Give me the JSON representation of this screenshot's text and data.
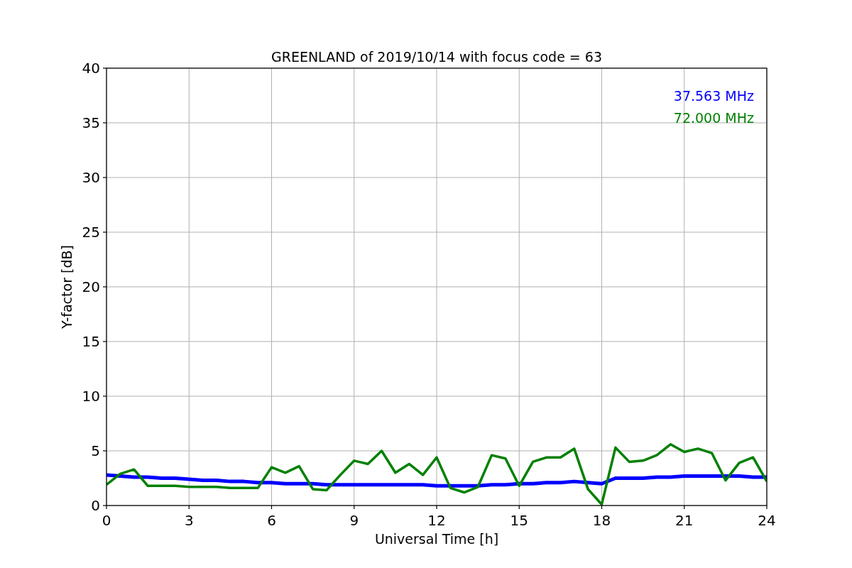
{
  "chart_data": {
    "type": "line",
    "title": "GREENLAND of 2019/10/14 with focus code = 63",
    "xlabel": "Universal Time [h]",
    "ylabel": "Y-factor [dB]",
    "x": [
      0,
      0.5,
      1,
      1.5,
      2,
      2.5,
      3,
      3.5,
      4,
      4.5,
      5,
      5.5,
      6,
      6.5,
      7,
      7.5,
      8,
      8.5,
      9,
      9.5,
      10,
      10.5,
      11,
      11.5,
      12,
      12.5,
      13,
      13.5,
      14,
      14.5,
      15,
      15.5,
      16,
      16.5,
      17,
      17.5,
      18,
      18.5,
      19,
      19.5,
      20,
      20.5,
      21,
      21.5,
      22,
      22.5,
      23,
      23.5,
      24
    ],
    "series": [
      {
        "name": "37.563 MHz",
        "color": "#0000ff",
        "values": [
          2.8,
          2.7,
          2.6,
          2.6,
          2.5,
          2.5,
          2.4,
          2.3,
          2.3,
          2.2,
          2.2,
          2.1,
          2.1,
          2.0,
          2.0,
          2.0,
          1.9,
          1.9,
          1.9,
          1.9,
          1.9,
          1.9,
          1.9,
          1.9,
          1.8,
          1.8,
          1.8,
          1.8,
          1.9,
          1.9,
          2.0,
          2.0,
          2.1,
          2.1,
          2.2,
          2.1,
          2.0,
          2.5,
          2.5,
          2.5,
          2.6,
          2.6,
          2.7,
          2.7,
          2.7,
          2.7,
          2.7,
          2.6,
          2.6
        ]
      },
      {
        "name": "72.000 MHz",
        "color": "#008000",
        "values": [
          1.9,
          2.9,
          3.3,
          1.8,
          1.8,
          1.8,
          1.7,
          1.7,
          1.7,
          1.6,
          1.6,
          1.6,
          3.5,
          3.0,
          3.6,
          1.5,
          1.4,
          2.8,
          4.1,
          3.8,
          5.0,
          3.0,
          3.8,
          2.8,
          4.4,
          1.6,
          1.2,
          1.7,
          4.6,
          4.3,
          1.8,
          4.0,
          4.4,
          4.4,
          5.2,
          1.5,
          0.1,
          5.3,
          4.0,
          4.1,
          4.6,
          5.6,
          4.9,
          5.2,
          4.8,
          2.3,
          3.9,
          4.4,
          2.2
        ]
      }
    ],
    "xlim": [
      0,
      24
    ],
    "ylim": [
      0,
      40
    ],
    "xticks": [
      0,
      3,
      6,
      9,
      12,
      15,
      18,
      21,
      24
    ],
    "yticks": [
      0,
      5,
      10,
      15,
      20,
      25,
      30,
      35,
      40
    ],
    "grid": true
  }
}
